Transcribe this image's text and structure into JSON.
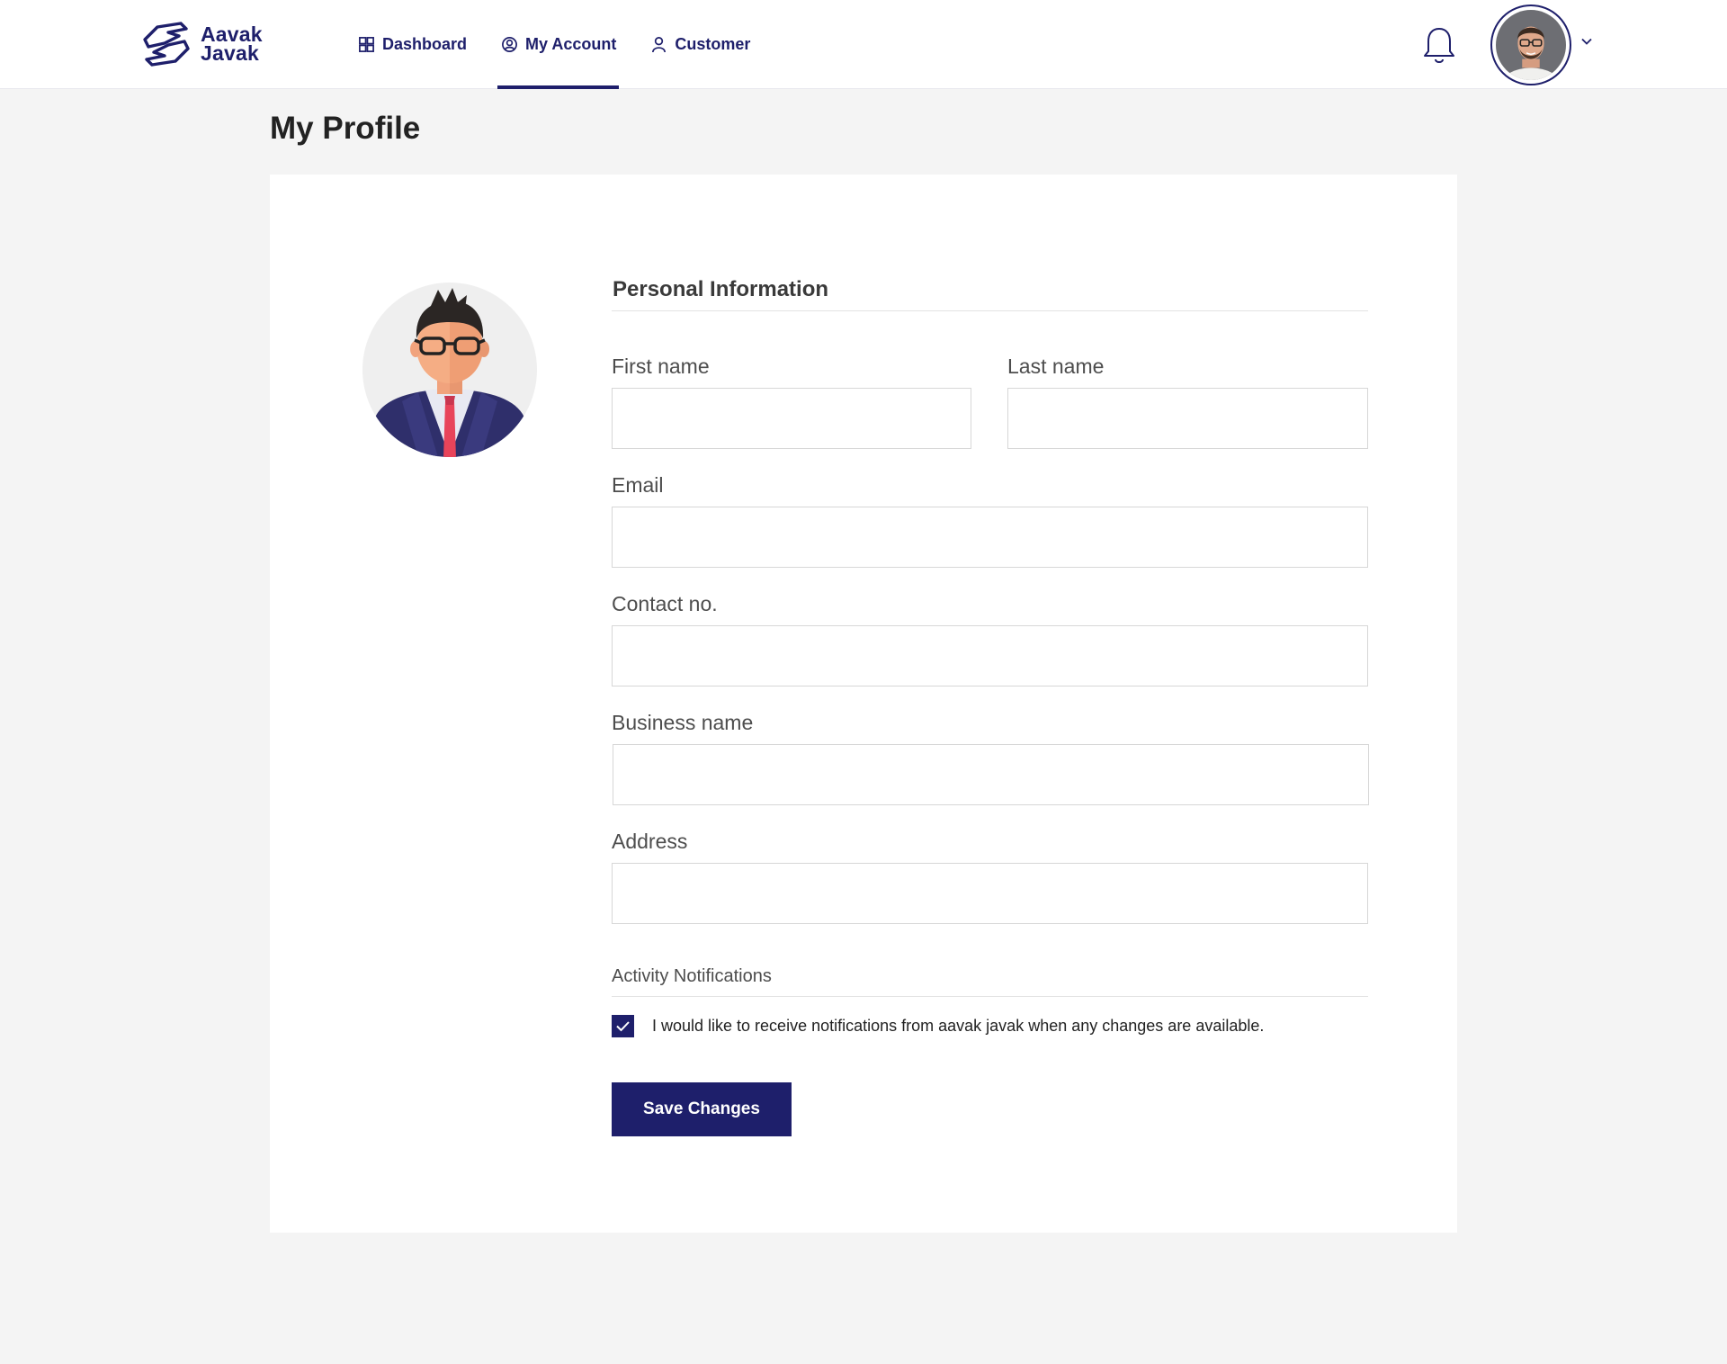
{
  "header": {
    "brand_line1": "Aavak",
    "brand_line2": "Javak",
    "nav": [
      {
        "label": "Dashboard",
        "icon": "dashboard-grid-icon",
        "active": false
      },
      {
        "label": "My Account",
        "icon": "user-circle-icon",
        "active": true
      },
      {
        "label": "Customer",
        "icon": "user-icon",
        "active": false
      }
    ]
  },
  "page": {
    "title": "My Profile"
  },
  "form": {
    "section_title": "Personal Information",
    "first_name_label": "First name",
    "first_name_value": "",
    "last_name_label": "Last name",
    "last_name_value": "",
    "email_label": "Email",
    "email_value": "",
    "contact_label": "Contact no.",
    "contact_value": "",
    "business_label": "Business name",
    "business_value": "",
    "address_label": "Address",
    "address_value": "",
    "notifications_title": "Activity Notifications",
    "notifications_checked": true,
    "notifications_text": "I would like to receive notifications from aavak javak when any changes are available.",
    "save_label": "Save Changes"
  },
  "colors": {
    "primary": "#1e1f6b",
    "page_bg": "#f4f4f4",
    "tie": "#e8445a"
  }
}
